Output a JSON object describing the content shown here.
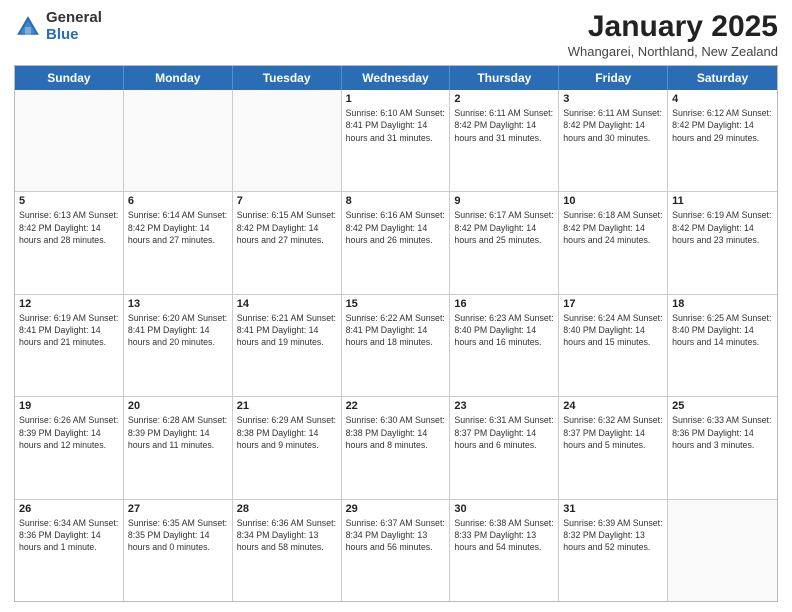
{
  "logo": {
    "general": "General",
    "blue": "Blue"
  },
  "header": {
    "month": "January 2025",
    "location": "Whangarei, Northland, New Zealand"
  },
  "weekdays": [
    "Sunday",
    "Monday",
    "Tuesday",
    "Wednesday",
    "Thursday",
    "Friday",
    "Saturday"
  ],
  "rows": [
    [
      {
        "day": "",
        "info": ""
      },
      {
        "day": "",
        "info": ""
      },
      {
        "day": "",
        "info": ""
      },
      {
        "day": "1",
        "info": "Sunrise: 6:10 AM\nSunset: 8:41 PM\nDaylight: 14 hours and 31 minutes."
      },
      {
        "day": "2",
        "info": "Sunrise: 6:11 AM\nSunset: 8:42 PM\nDaylight: 14 hours and 31 minutes."
      },
      {
        "day": "3",
        "info": "Sunrise: 6:11 AM\nSunset: 8:42 PM\nDaylight: 14 hours and 30 minutes."
      },
      {
        "day": "4",
        "info": "Sunrise: 6:12 AM\nSunset: 8:42 PM\nDaylight: 14 hours and 29 minutes."
      }
    ],
    [
      {
        "day": "5",
        "info": "Sunrise: 6:13 AM\nSunset: 8:42 PM\nDaylight: 14 hours and 28 minutes."
      },
      {
        "day": "6",
        "info": "Sunrise: 6:14 AM\nSunset: 8:42 PM\nDaylight: 14 hours and 27 minutes."
      },
      {
        "day": "7",
        "info": "Sunrise: 6:15 AM\nSunset: 8:42 PM\nDaylight: 14 hours and 27 minutes."
      },
      {
        "day": "8",
        "info": "Sunrise: 6:16 AM\nSunset: 8:42 PM\nDaylight: 14 hours and 26 minutes."
      },
      {
        "day": "9",
        "info": "Sunrise: 6:17 AM\nSunset: 8:42 PM\nDaylight: 14 hours and 25 minutes."
      },
      {
        "day": "10",
        "info": "Sunrise: 6:18 AM\nSunset: 8:42 PM\nDaylight: 14 hours and 24 minutes."
      },
      {
        "day": "11",
        "info": "Sunrise: 6:19 AM\nSunset: 8:42 PM\nDaylight: 14 hours and 23 minutes."
      }
    ],
    [
      {
        "day": "12",
        "info": "Sunrise: 6:19 AM\nSunset: 8:41 PM\nDaylight: 14 hours and 21 minutes."
      },
      {
        "day": "13",
        "info": "Sunrise: 6:20 AM\nSunset: 8:41 PM\nDaylight: 14 hours and 20 minutes."
      },
      {
        "day": "14",
        "info": "Sunrise: 6:21 AM\nSunset: 8:41 PM\nDaylight: 14 hours and 19 minutes."
      },
      {
        "day": "15",
        "info": "Sunrise: 6:22 AM\nSunset: 8:41 PM\nDaylight: 14 hours and 18 minutes."
      },
      {
        "day": "16",
        "info": "Sunrise: 6:23 AM\nSunset: 8:40 PM\nDaylight: 14 hours and 16 minutes."
      },
      {
        "day": "17",
        "info": "Sunrise: 6:24 AM\nSunset: 8:40 PM\nDaylight: 14 hours and 15 minutes."
      },
      {
        "day": "18",
        "info": "Sunrise: 6:25 AM\nSunset: 8:40 PM\nDaylight: 14 hours and 14 minutes."
      }
    ],
    [
      {
        "day": "19",
        "info": "Sunrise: 6:26 AM\nSunset: 8:39 PM\nDaylight: 14 hours and 12 minutes."
      },
      {
        "day": "20",
        "info": "Sunrise: 6:28 AM\nSunset: 8:39 PM\nDaylight: 14 hours and 11 minutes."
      },
      {
        "day": "21",
        "info": "Sunrise: 6:29 AM\nSunset: 8:38 PM\nDaylight: 14 hours and 9 minutes."
      },
      {
        "day": "22",
        "info": "Sunrise: 6:30 AM\nSunset: 8:38 PM\nDaylight: 14 hours and 8 minutes."
      },
      {
        "day": "23",
        "info": "Sunrise: 6:31 AM\nSunset: 8:37 PM\nDaylight: 14 hours and 6 minutes."
      },
      {
        "day": "24",
        "info": "Sunrise: 6:32 AM\nSunset: 8:37 PM\nDaylight: 14 hours and 5 minutes."
      },
      {
        "day": "25",
        "info": "Sunrise: 6:33 AM\nSunset: 8:36 PM\nDaylight: 14 hours and 3 minutes."
      }
    ],
    [
      {
        "day": "26",
        "info": "Sunrise: 6:34 AM\nSunset: 8:36 PM\nDaylight: 14 hours and 1 minute."
      },
      {
        "day": "27",
        "info": "Sunrise: 6:35 AM\nSunset: 8:35 PM\nDaylight: 14 hours and 0 minutes."
      },
      {
        "day": "28",
        "info": "Sunrise: 6:36 AM\nSunset: 8:34 PM\nDaylight: 13 hours and 58 minutes."
      },
      {
        "day": "29",
        "info": "Sunrise: 6:37 AM\nSunset: 8:34 PM\nDaylight: 13 hours and 56 minutes."
      },
      {
        "day": "30",
        "info": "Sunrise: 6:38 AM\nSunset: 8:33 PM\nDaylight: 13 hours and 54 minutes."
      },
      {
        "day": "31",
        "info": "Sunrise: 6:39 AM\nSunset: 8:32 PM\nDaylight: 13 hours and 52 minutes."
      },
      {
        "day": "",
        "info": ""
      }
    ]
  ]
}
